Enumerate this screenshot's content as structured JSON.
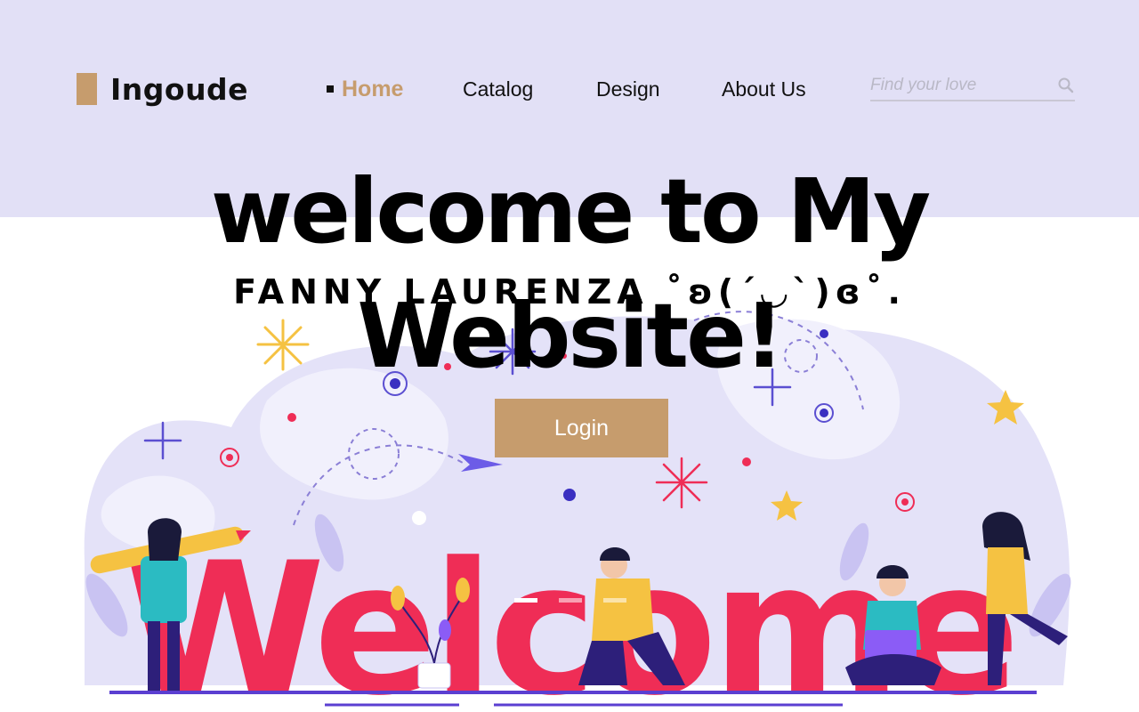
{
  "brand": {
    "name": "Ingoude",
    "accent": "#c69c6d",
    "band_color": "#e2e0f6"
  },
  "nav": {
    "items": [
      {
        "label": "Home",
        "active": true
      },
      {
        "label": "Catalog",
        "active": false
      },
      {
        "label": "Design",
        "active": false
      },
      {
        "label": "About Us",
        "active": false
      }
    ]
  },
  "search": {
    "placeholder": "Find your love",
    "icon": "search-icon"
  },
  "hero": {
    "title": "welcome to My Website!",
    "subtitle": "FANNY LAURENZA ˚ʚ(´◡`)ɞ˚.",
    "login_label": "Login"
  },
  "illustration": {
    "word": "Welcome",
    "word_color": "#ef2d56"
  },
  "slider": {
    "dots": 3,
    "active_index": 0
  }
}
